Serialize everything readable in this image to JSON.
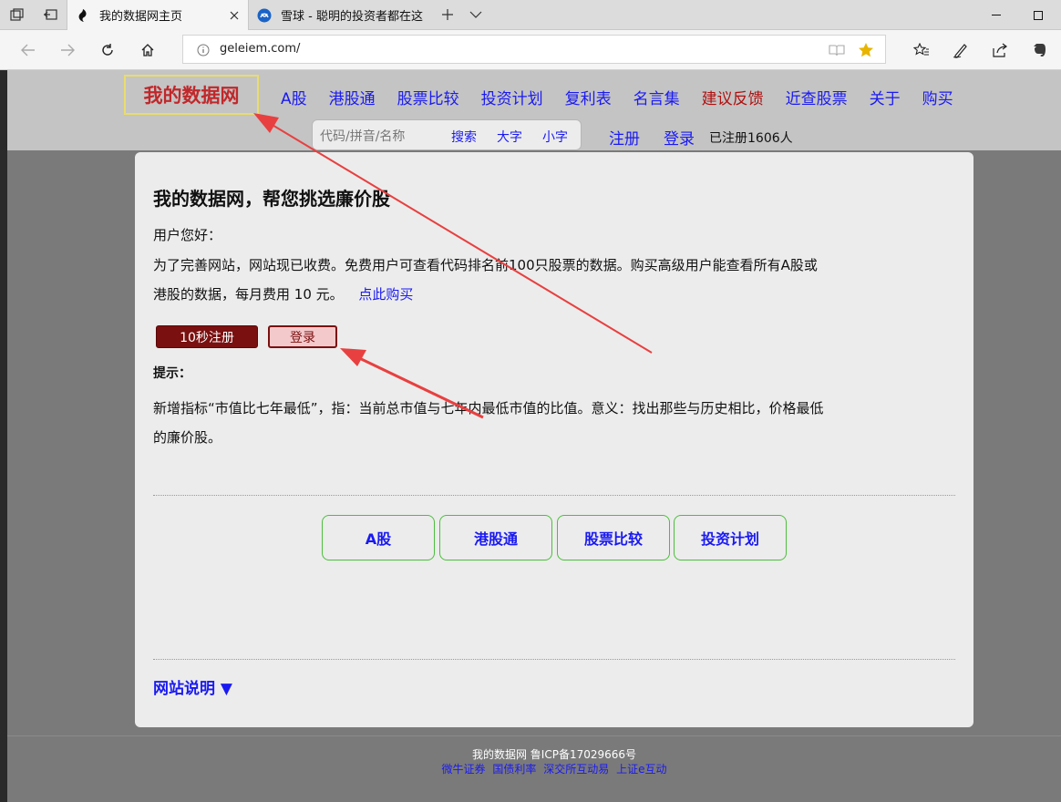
{
  "browser": {
    "tabs": [
      {
        "title": "我的数据网主页",
        "active": true,
        "favicon": "leaf-favicon-icon"
      },
      {
        "title": "雪球 - 聪明的投资者都在这",
        "active": false,
        "favicon": "snowball-favicon-icon"
      }
    ],
    "url": "geleiem.com/",
    "icons": [
      "tab-preview-icon",
      "set-aside-tabs-icon",
      "back-icon",
      "forward-icon",
      "refresh-icon",
      "home-icon",
      "info-icon",
      "reading-view-icon",
      "favorite-star-icon",
      "favorites-hub-icon",
      "pen-icon",
      "share-icon",
      "evernote-icon"
    ],
    "accent_star": "#e8b400"
  },
  "site": {
    "logo": "我的数据网",
    "nav": [
      {
        "label": "A股",
        "color": "#1a1af2"
      },
      {
        "label": "港股通",
        "color": "#1a1af2"
      },
      {
        "label": "股票比较",
        "color": "#1a1af2"
      },
      {
        "label": "投资计划",
        "color": "#1a1af2"
      },
      {
        "label": "复利表",
        "color": "#1a1af2"
      },
      {
        "label": "名言集",
        "color": "#1a1af2"
      },
      {
        "label": "建议反馈",
        "color": "#b01010"
      },
      {
        "label": "近查股票",
        "color": "#1a1af2"
      },
      {
        "label": "关于",
        "color": "#1a1af2"
      },
      {
        "label": "购买",
        "color": "#1a1af2"
      }
    ],
    "search": {
      "placeholder": "代码/拼音/名称",
      "search_label": "搜索",
      "big_font_label": "大字",
      "small_font_label": "小字"
    },
    "register_label": "注册",
    "login_label": "登录",
    "registered_count_text": "已注册1606人"
  },
  "main": {
    "heading": "我的数据网，帮您挑选廉价股",
    "greeting": "用户您好：",
    "notice_line1": "为了完善网站，网站现已收费。免费用户可查看代码排名前100只股票的数据。购买高级用户能查看所有A股或",
    "notice_line2": "港股的数据，每月费用 10 元。",
    "buy_link": "点此购买",
    "register_button": "10秒注册",
    "login_button": "登录",
    "tip_label": "提示：",
    "tip_line1": "新增指标“市值比七年最低”，指：当前总市值与七年内最低市值的比值。意义：找出那些与历史相比，价格最低",
    "tip_line2": "的廉价股。",
    "quick_buttons": [
      "A股",
      "港股通",
      "股票比较",
      "投资计划"
    ],
    "site_desc_label": "网站说明 ▼"
  },
  "footer": {
    "line1": "我的数据网 鲁ICP备17029666号",
    "links": [
      "微牛证券",
      "国债利率",
      "深交所互动易",
      "上证e互动"
    ]
  }
}
